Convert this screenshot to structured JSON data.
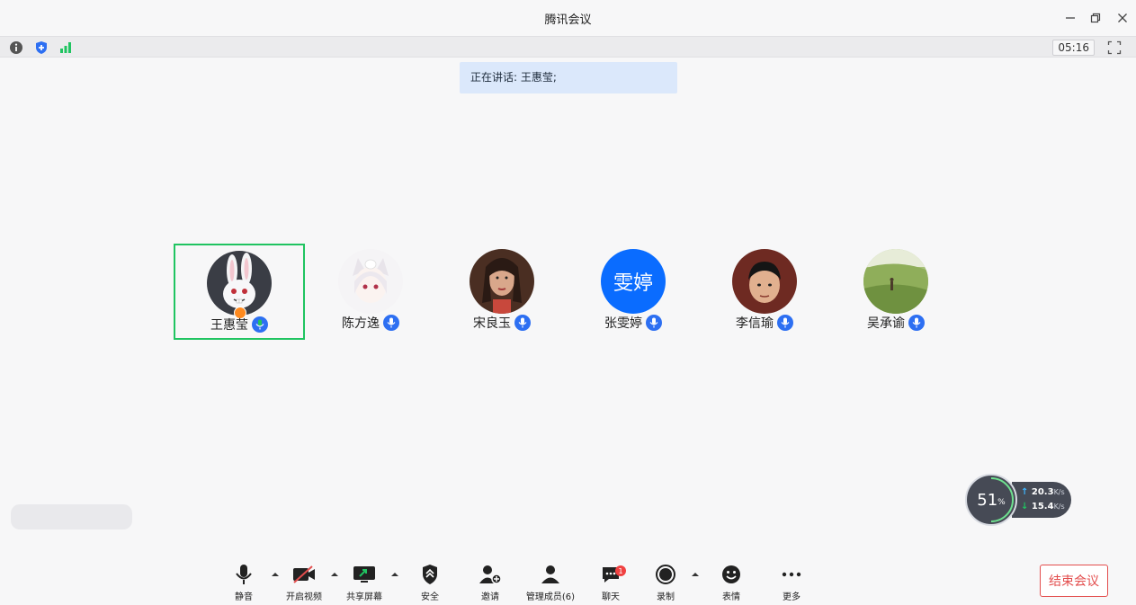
{
  "window": {
    "title": "腾讯会议"
  },
  "status": {
    "timer": "05:16"
  },
  "speaking": {
    "text": "正在讲话: 王惠莹;"
  },
  "participants": [
    {
      "name": "王惠莹",
      "avatar": "bunny-photo",
      "host": true,
      "active": true
    },
    {
      "name": "陈方逸",
      "avatar": "anime-cat-girl"
    },
    {
      "name": "宋良玉",
      "avatar": "woman-portrait"
    },
    {
      "name": "张雯婷",
      "avatar": "initials",
      "initials": "雯婷",
      "color": "#0a6cff"
    },
    {
      "name": "李信瑜",
      "avatar": "boy-portrait"
    },
    {
      "name": "吴承谕",
      "avatar": "meadow-photo"
    }
  ],
  "network": {
    "percent": "51",
    "percent_unit": "%",
    "up": "20.3",
    "down": "15.4",
    "unit": "K/s"
  },
  "toolbar": {
    "mute": "静音",
    "video": "开启视频",
    "share": "共享屏幕",
    "security": "安全",
    "invite": "邀请",
    "members": "管理成员(6)",
    "chat": "聊天",
    "chat_badge": "1",
    "record": "录制",
    "reaction": "表情",
    "more": "更多",
    "end": "结束会议"
  },
  "colors": {
    "accent_green": "#20c461",
    "mic_blue": "#2d6ff2",
    "end_red": "#e34d4d",
    "banner": "#dbe8fb"
  }
}
